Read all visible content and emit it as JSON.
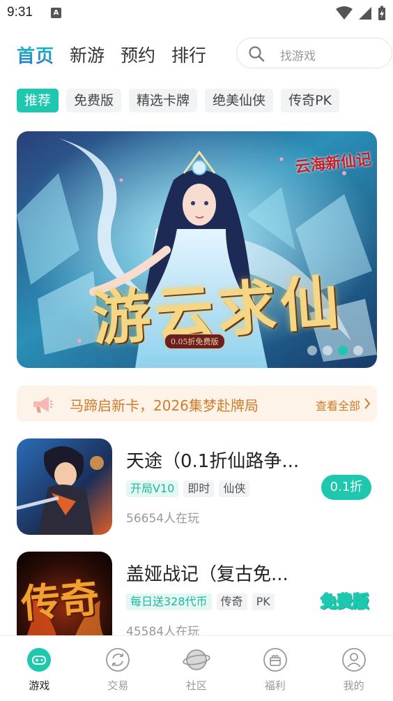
{
  "status_bar": {
    "time": "9:31",
    "notification_badge": "A"
  },
  "top_nav": {
    "home": "首页",
    "items": [
      "新游",
      "预约",
      "排行"
    ],
    "search_placeholder": "找游戏"
  },
  "chips": [
    "推荐",
    "免费版",
    "精选卡牌",
    "绝美仙侠",
    "传奇PK"
  ],
  "banner": {
    "logo": "云海新仙记",
    "title": "游云求仙",
    "tag": "0.05折免费版",
    "dots": 4,
    "active_dot": 2
  },
  "notice": {
    "text": "马蹄启新卡，2026集梦赴牌局",
    "more": "查看全部"
  },
  "games": [
    {
      "title": "天途（0.1折仙路争...",
      "tags": [
        {
          "text": "开局V10",
          "highlight": true
        },
        {
          "text": "即时",
          "highlight": false
        },
        {
          "text": "仙侠",
          "highlight": false
        }
      ],
      "players": "56654人在玩",
      "action": "0.1折"
    },
    {
      "title": "盖娅战记（复古免...",
      "icon_text": "传奇",
      "tags": [
        {
          "text": "每日送328代币",
          "highlight": true
        },
        {
          "text": "传奇",
          "highlight": false
        },
        {
          "text": "PK",
          "highlight": false
        }
      ],
      "players": "45584人在玩",
      "action": "免费版"
    }
  ],
  "bottom_nav": [
    {
      "label": "游戏",
      "icon": "gamepad-icon",
      "active": true
    },
    {
      "label": "交易",
      "icon": "trade-icon",
      "active": false
    },
    {
      "label": "社区",
      "icon": "planet-icon",
      "active": false
    },
    {
      "label": "福利",
      "icon": "gift-icon",
      "active": false
    },
    {
      "label": "我的",
      "icon": "user-icon",
      "active": false
    }
  ],
  "colors": {
    "accent": "#1ec8ae",
    "notice": "#d27b2a",
    "notice_bg": "#fdf3e8"
  }
}
